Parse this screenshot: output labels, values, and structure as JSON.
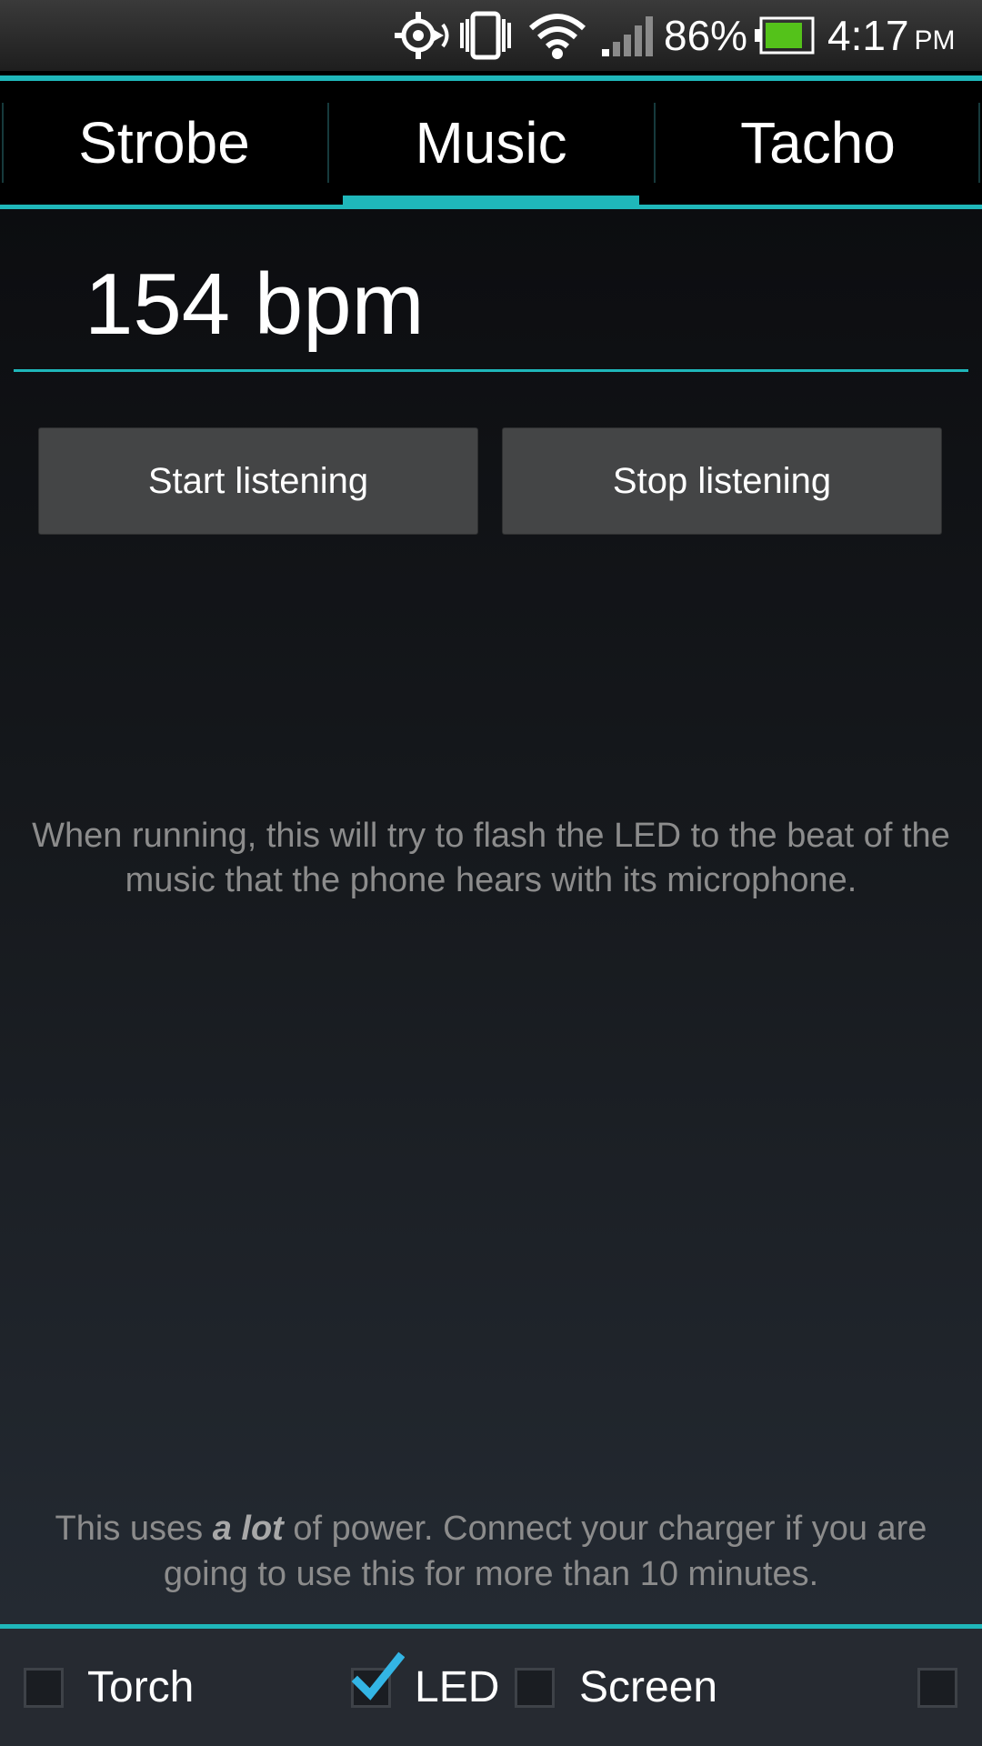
{
  "status_bar": {
    "battery_percent": "86%",
    "battery_level": 0.86,
    "time": "4:17",
    "ampm": "PM",
    "icons": [
      "location-icon",
      "vibrate-icon",
      "wifi-icon",
      "signal-icon",
      "battery-icon"
    ],
    "battery_color": "#54c21a"
  },
  "tabs": [
    {
      "label": "Strobe",
      "selected": false
    },
    {
      "label": "Music",
      "selected": true
    },
    {
      "label": "Tacho",
      "selected": false
    }
  ],
  "music": {
    "bpm_display": "154 bpm",
    "start_button_label": "Start listening",
    "stop_button_label": "Stop listening",
    "description": "When running, this will try to flash the LED to the beat of the music that the phone hears with its microphone.",
    "power_note_before": "This uses ",
    "power_note_emphasis": "a lot",
    "power_note_after": " of power. Connect your charger if you are going to use this for more than 10 minutes."
  },
  "bottom_options": [
    {
      "label": "Torch",
      "checked": false
    },
    {
      "label": "LED",
      "checked": true
    },
    {
      "label": "Screen",
      "checked": false
    },
    {
      "label": "",
      "checked": false
    }
  ],
  "colors": {
    "accent": "#1fb7ba",
    "check": "#33b5e5",
    "button_bg": "#444546",
    "muted_text": "#8c8c8c"
  }
}
